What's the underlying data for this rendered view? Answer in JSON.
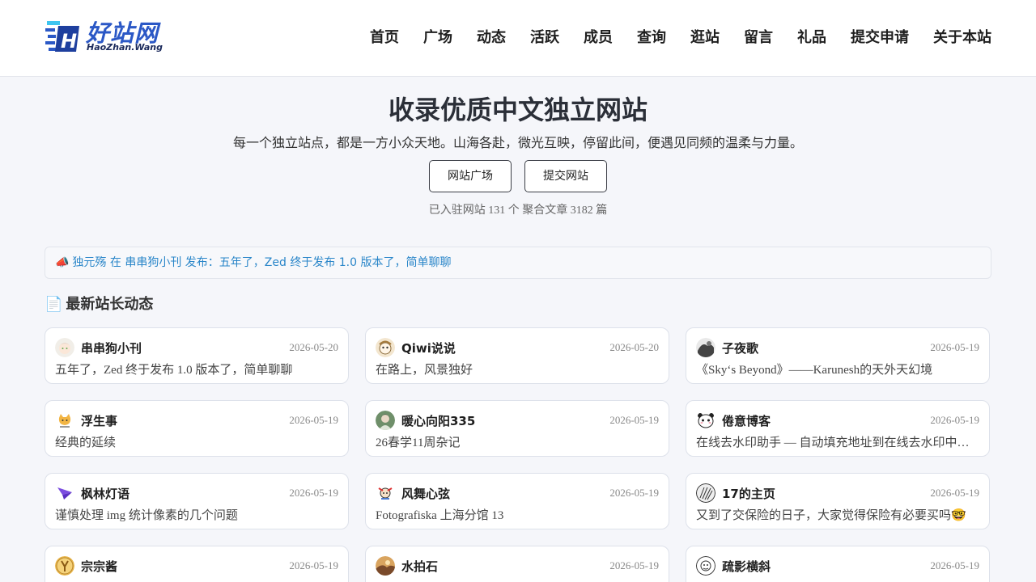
{
  "site": {
    "logo_text": "好站网",
    "logo_sub": "HaoZhan.Wang",
    "brand_color": "#2b58c6"
  },
  "nav": [
    "首页",
    "广场",
    "动态",
    "活跃",
    "成员",
    "查询",
    "逛站",
    "留言",
    "礼品",
    "提交申请",
    "关于本站"
  ],
  "hero": {
    "title": "收录优质中文独立网站",
    "subtitle": "每一个独立站点，都是一方小众天地。山海各赴，微光互映，停留此间，便遇见同频的温柔与力量。",
    "btn_square": "网站广场",
    "btn_submit": "提交网站",
    "stats": "已入驻网站 131 个 聚合文章 3182 篇"
  },
  "notice": {
    "icon": "megaphone-icon",
    "text": "独元殇 在 串串狗小刊 发布：五年了，Zed 终于发布 1.0 版本了，简单聊聊",
    "color": "#2a86c9"
  },
  "section": {
    "icon": "document-icon",
    "title": "最新站长动态"
  },
  "cards": [
    {
      "name": "串串狗小刊",
      "date": "2026-05-20",
      "post": "五年了，Zed 终于发布 1.0 版本了，简单聊聊",
      "avatar": "anime-avatar"
    },
    {
      "name": "Qiwi说说",
      "date": "2026-05-20",
      "post": "在路上，风景独好",
      "avatar": "cartoon-avatar"
    },
    {
      "name": "子夜歌",
      "date": "2026-05-19",
      "post": "《Sky‘s Beyond》——Karunesh的天外天幻境",
      "avatar": "ink-avatar"
    },
    {
      "name": "浮生事",
      "date": "2026-05-19",
      "post": "经典的延续",
      "avatar": "cat-avatar"
    },
    {
      "name": "暖心向阳335",
      "date": "2026-05-19",
      "post": "26春学11周杂记",
      "avatar": "photo-avatar"
    },
    {
      "name": "倦意博客",
      "date": "2026-05-19",
      "post": "在线去水印助手 — 自动填充地址到在线去水印中…",
      "avatar": "panda-avatar"
    },
    {
      "name": "枫林灯语",
      "date": "2026-05-19",
      "post": "谨慎处理 img 统计像素的几个问题",
      "avatar": "paper-plane-avatar"
    },
    {
      "name": "风舞心弦",
      "date": "2026-05-19",
      "post": "Fotografiska 上海分馆 13",
      "avatar": "character-avatar"
    },
    {
      "name": "17的主页",
      "date": "2026-05-19",
      "post": "又到了交保险的日子，大家觉得保险有必要买吗🤓",
      "avatar": "sketch-avatar"
    },
    {
      "name": "宗宗酱",
      "date": "2026-05-19",
      "post": "",
      "avatar": "gold-avatar"
    },
    {
      "name": "水拍石",
      "date": "2026-05-19",
      "post": "",
      "avatar": "sunset-avatar"
    },
    {
      "name": "疏影横斜",
      "date": "2026-05-19",
      "post": "",
      "avatar": "sketch-round-avatar"
    }
  ]
}
